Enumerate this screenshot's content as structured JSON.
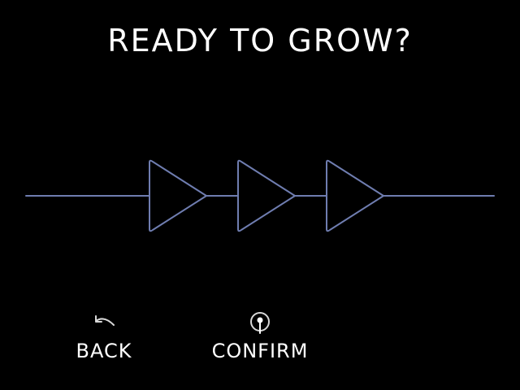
{
  "screen": {
    "title": "READY TO GROW?"
  },
  "graphic": {
    "name": "growth-arrows",
    "stroke_color": "#6F7DB0",
    "chevron_count": 3
  },
  "actions": {
    "back": {
      "label": "BACK",
      "icon": "undo-arrow-icon"
    },
    "confirm": {
      "label": "CONFIRM",
      "icon": "pin-circle-icon"
    }
  },
  "colors": {
    "background": "#000000",
    "text": "#FFFFFF",
    "icon": "#D8D8D8",
    "accent": "#6F7DB0"
  }
}
